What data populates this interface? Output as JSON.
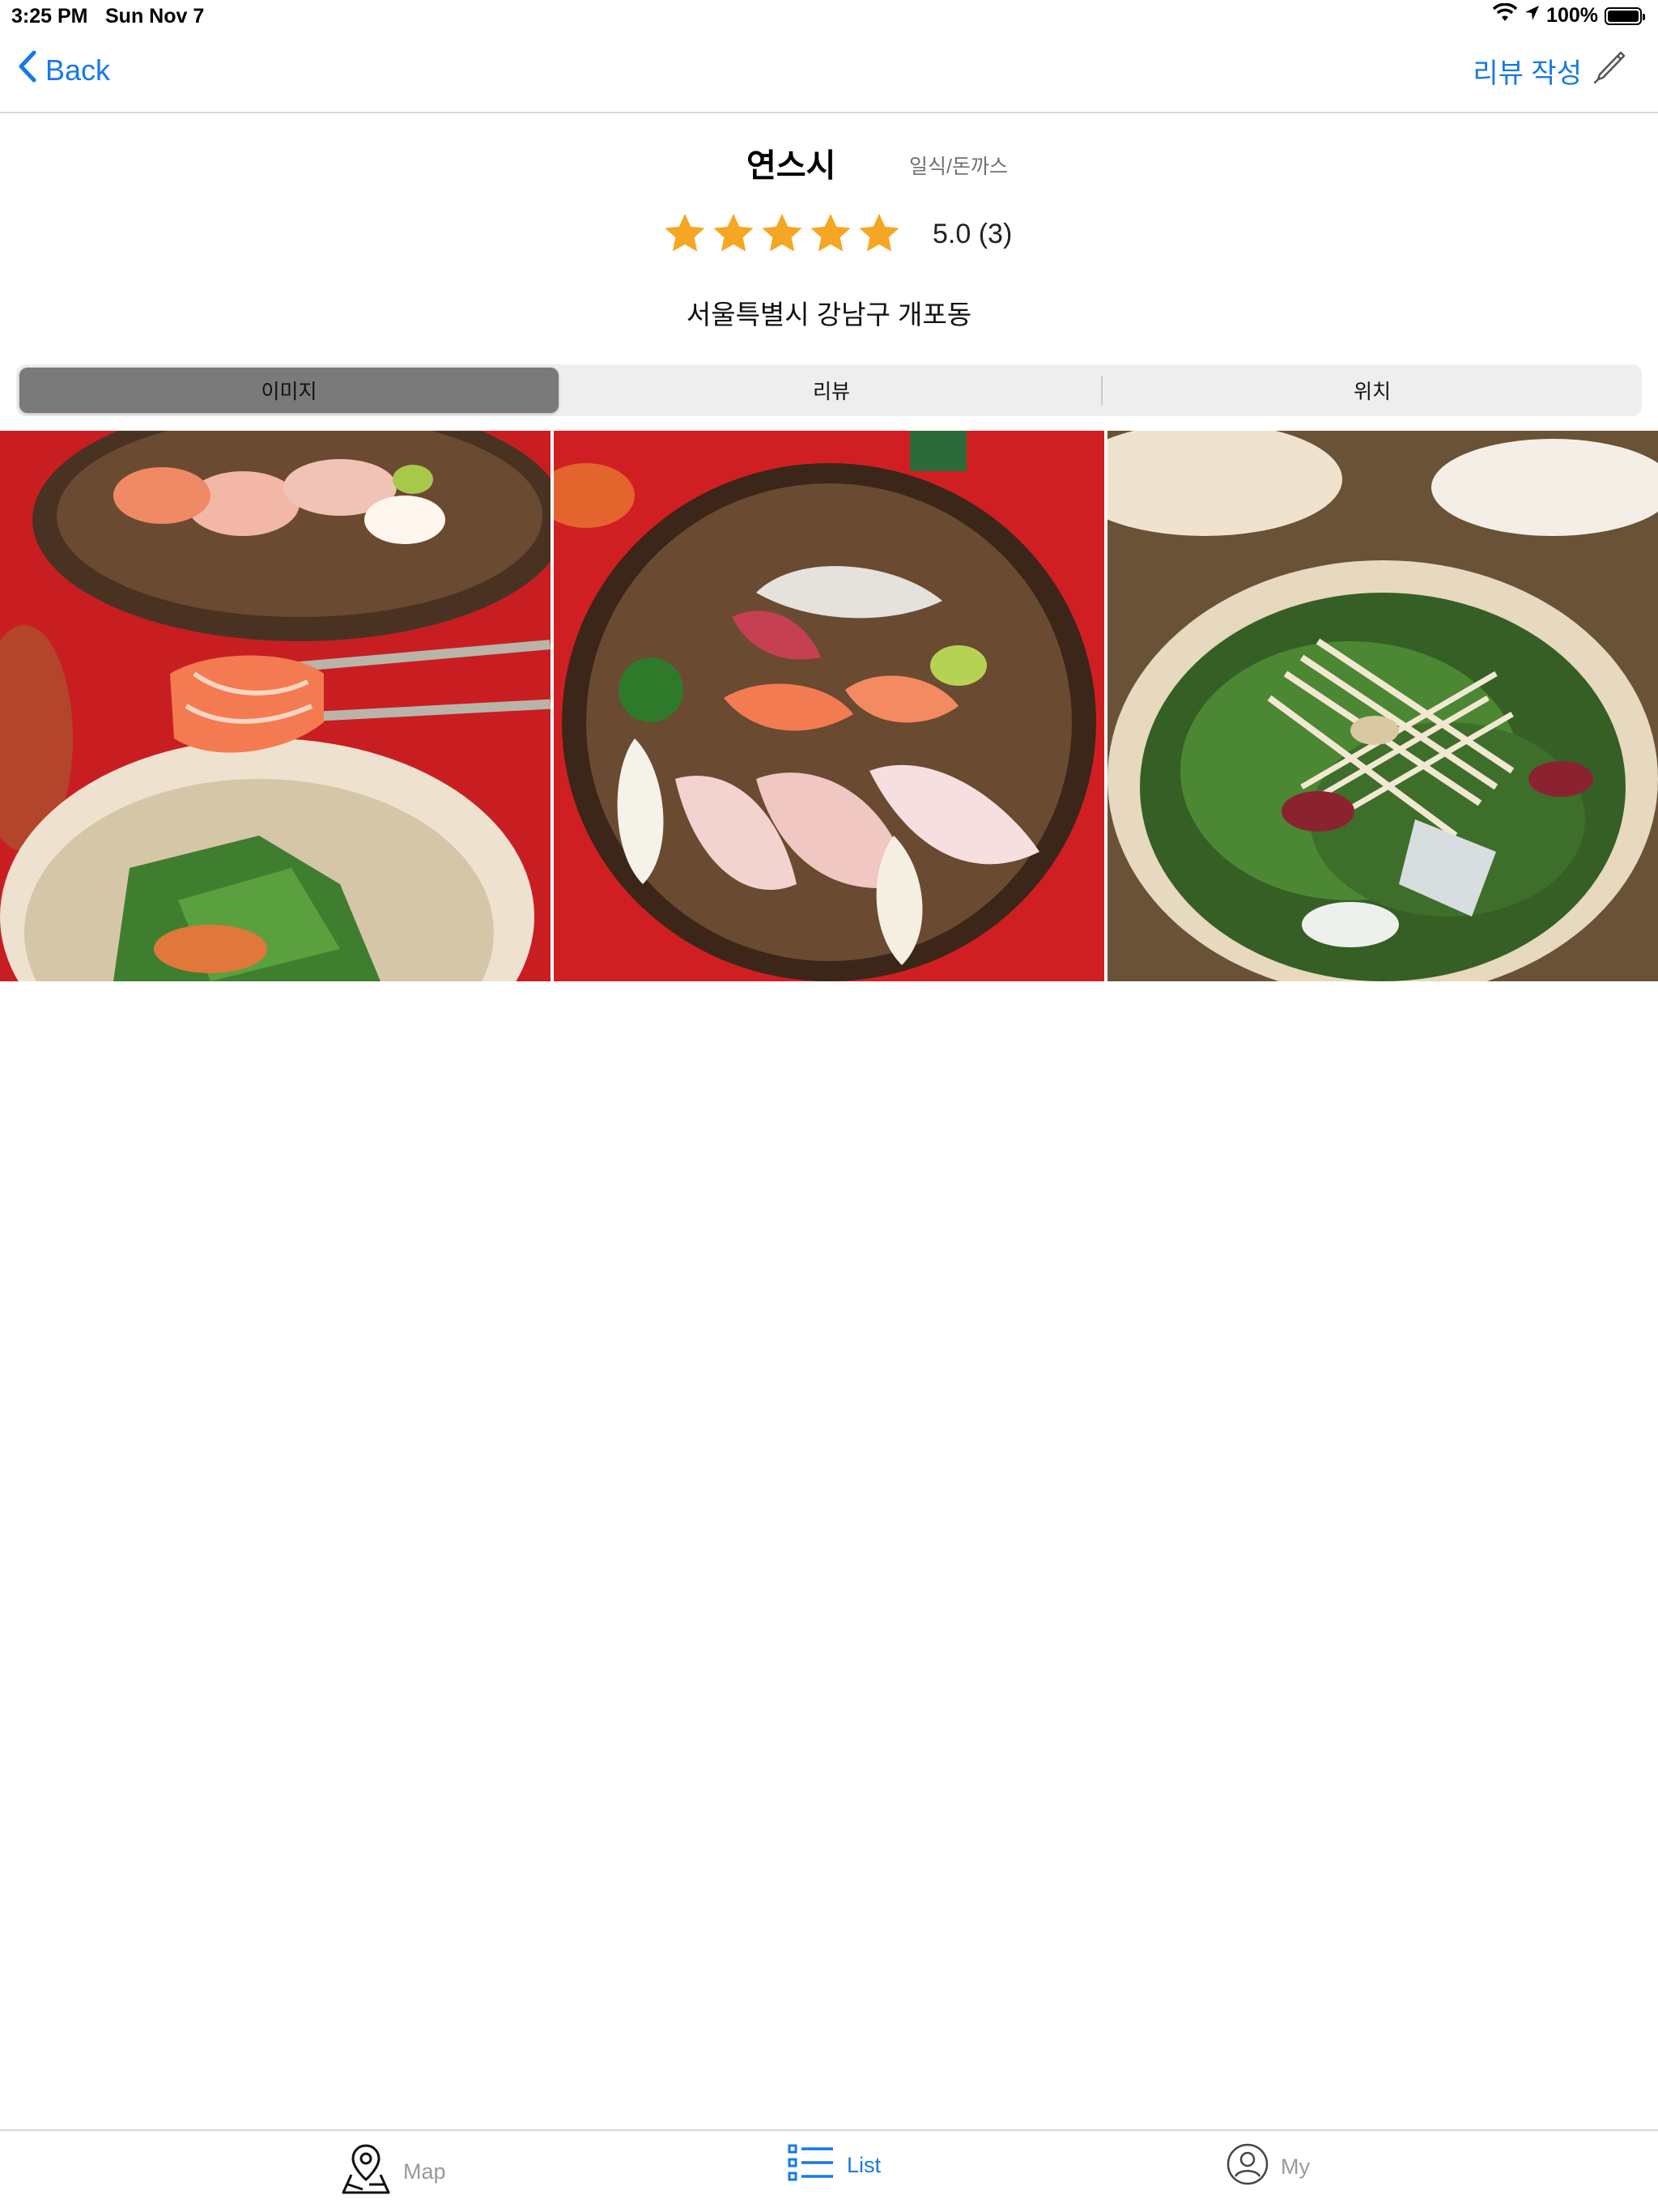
{
  "status_bar": {
    "time": "3:25 PM",
    "date": "Sun Nov 7",
    "battery": "100%"
  },
  "nav": {
    "back_label": "Back",
    "write_review_label": "리뷰 작성"
  },
  "place": {
    "name": "연스시",
    "category": "일식/돈까스",
    "rating_text": "5.0 (3)",
    "rating_value": 5,
    "rating_max": 5,
    "address": "서울특별시 강남구 개포동"
  },
  "segments": [
    {
      "label": "이미지",
      "active": true
    },
    {
      "label": "리뷰",
      "active": false
    },
    {
      "label": "위치",
      "active": false
    }
  ],
  "gallery": {
    "photos": [
      {
        "subject": "salmon sashimi on chopsticks with side dishes"
      },
      {
        "subject": "assorted sashimi platter"
      },
      {
        "subject": "sashimi salad bowl"
      }
    ]
  },
  "tab_bar": {
    "items": [
      {
        "label": "Map",
        "icon": "map-pin-icon",
        "active": false
      },
      {
        "label": "List",
        "icon": "list-icon",
        "active": true
      },
      {
        "label": "My",
        "icon": "user-circle-icon",
        "active": false
      }
    ]
  },
  "colors": {
    "accent": "#1679e8",
    "star": "#f5a623",
    "segment_active": "#7a7a7a"
  }
}
